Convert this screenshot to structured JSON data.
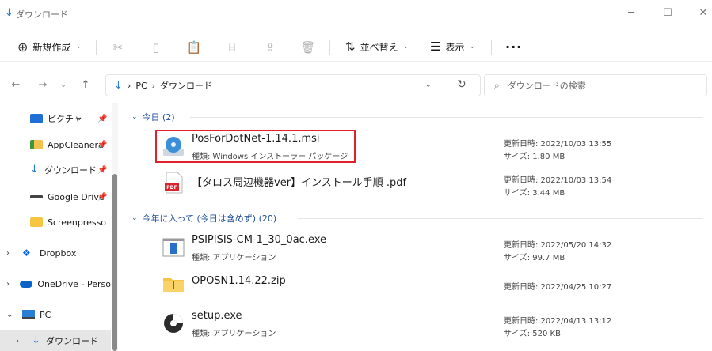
{
  "window": {
    "title": "ダウンロード",
    "icon": "download-arrow-icon"
  },
  "commandbar": {
    "new_label": "新規作成",
    "sort_label": "並べ替え",
    "view_label": "表示",
    "more_label": "···"
  },
  "address": {
    "crumbs": [
      "PC",
      "ダウンロード"
    ],
    "search_placeholder": "ダウンロードの検索"
  },
  "sidebar": {
    "items": [
      {
        "label": "ピクチャ",
        "icon": "pictures-icon",
        "pinned": true
      },
      {
        "label": "AppCleanera",
        "icon": "folder-green-icon",
        "pinned": true
      },
      {
        "label": "ダウンロード",
        "icon": "download-arrow-icon",
        "pinned": true
      },
      {
        "label": "Google Drive",
        "icon": "drive-icon",
        "pinned": true
      },
      {
        "label": "Screenpresso",
        "icon": "folder-icon",
        "pinned": false
      },
      {
        "label": "Dropbox",
        "icon": "dropbox-icon",
        "pinned": false
      },
      {
        "label": "OneDrive - Perso",
        "icon": "onedrive-icon",
        "pinned": false
      },
      {
        "label": "PC",
        "icon": "pc-icon",
        "pinned": false
      },
      {
        "label": "ダウンロード",
        "icon": "download-arrow-icon",
        "pinned": false
      }
    ]
  },
  "groups": [
    {
      "header": "今日 (2)",
      "files": [
        {
          "name": "PosForDotNet-1.14.1.msi",
          "type": "種類: Windows インストーラー パッケージ",
          "date": "更新日時: 2022/10/03 13:55",
          "size": "サイズ: 1.80 MB",
          "icon": "msi-installer-icon"
        },
        {
          "name": "【タロス周辺機器ver】インストール手順 .pdf",
          "type": "",
          "date": "更新日時: 2022/10/03 13:54",
          "size": "サイズ: 3.44 MB",
          "icon": "pdf-icon"
        }
      ]
    },
    {
      "header": "今年に入って (今日は含めず) (20)",
      "files": [
        {
          "name": "PSIPISIS-CM-1_30_0ac.exe",
          "type": "種類: アプリケーション",
          "date": "更新日時: 2022/05/20 14:32",
          "size": "サイズ: 99.7 MB",
          "icon": "exe-app-icon"
        },
        {
          "name": "OPOSN1.14.22.zip",
          "type": "",
          "date": "更新日時: 2022/04/25 10:27",
          "size": "",
          "icon": "zip-folder-icon"
        },
        {
          "name": "setup.exe",
          "type": "種類: アプリケーション",
          "date": "更新日時: 2022/04/13 13:12",
          "size": "サイズ: 520 KB",
          "icon": "setup-disc-icon"
        }
      ]
    }
  ],
  "colors": {
    "accent": "#2a7fd4",
    "group_header": "#1f4e99",
    "highlight": "#e0202a"
  }
}
